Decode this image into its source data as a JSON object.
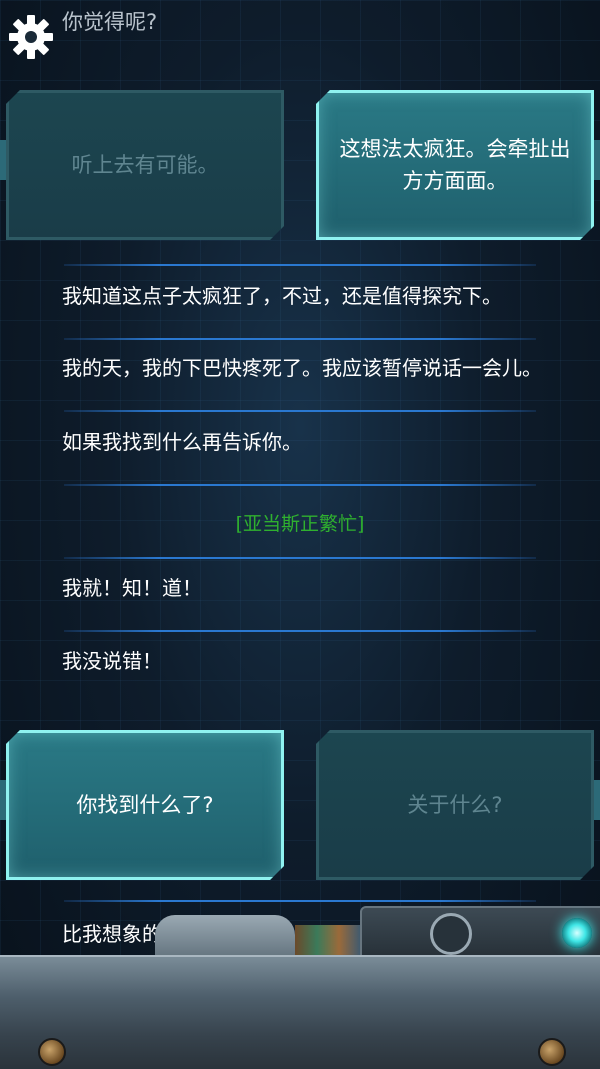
{
  "header": {
    "previous_line": "你觉得呢?"
  },
  "choices_top": [
    {
      "label": "听上去有可能。",
      "state": "unselected"
    },
    {
      "label": "这想法太疯狂。会牵扯出方方面面。",
      "state": "selected"
    }
  ],
  "messages": [
    "我知道这点子太疯狂了，不过，还是值得探究下。",
    "我的天，我的下巴快疼死了。我应该暂停说话一会儿。",
    "如果我找到什么再告诉你。"
  ],
  "status": "[亚当斯正繁忙]",
  "messages2": [
    "我就！知！道！",
    "我没说错！"
  ],
  "choices_bottom": [
    {
      "label": "你找到什么了?",
      "state": "selected"
    },
    {
      "label": "关于什么?",
      "state": "unselected"
    }
  ],
  "partial_message": "比我想象的",
  "colors": {
    "status_green": "#2fb02f",
    "accent_cyan": "#8ff2f0",
    "separator_blue": "#2a78d0"
  },
  "icons": {
    "settings": "gear-icon"
  }
}
